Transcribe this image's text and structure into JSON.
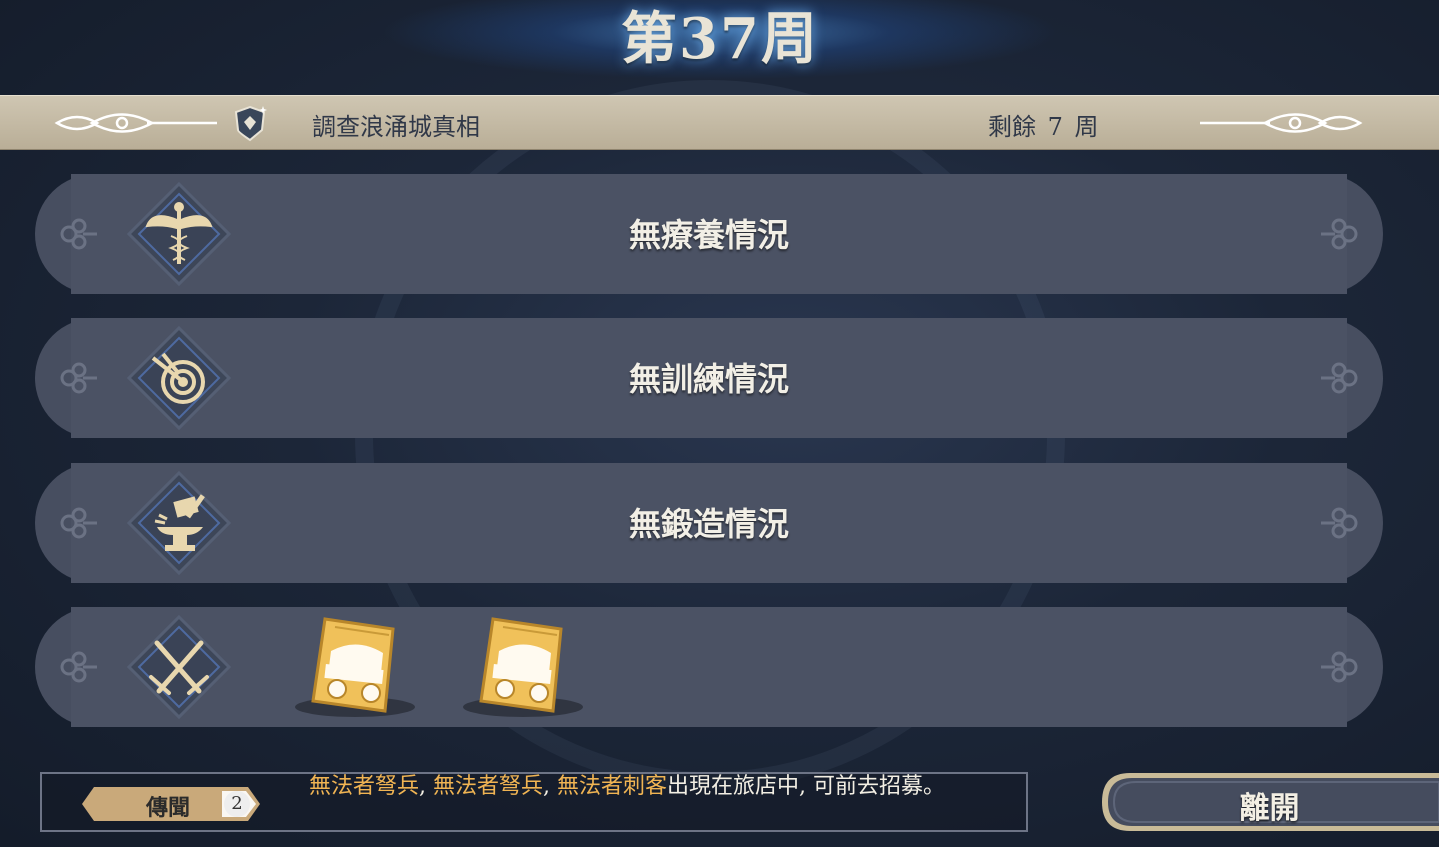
{
  "header": {
    "week_title": "第37周"
  },
  "quest": {
    "name": "調查浪涌城真相",
    "remaining": "剩餘 7 周"
  },
  "rows": [
    {
      "icon": "caduceus-icon",
      "label": "無療養情況"
    },
    {
      "icon": "target-icon",
      "label": "無訓練情況"
    },
    {
      "icon": "anvil-icon",
      "label": "無鍛造情況"
    },
    {
      "icon": "crossed-swords-icon",
      "label": ""
    }
  ],
  "reward_cards": [
    {
      "icon": "wagon-card-icon"
    },
    {
      "icon": "wagon-card-icon"
    }
  ],
  "rumor": {
    "label": "傳聞",
    "count": "2",
    "unit1": "無法者弩兵",
    "sep1": ", ",
    "unit2": "無法者弩兵",
    "sep2": ", ",
    "unit3": "無法者刺客",
    "rest": "出現在旅店中, 可前去招募。"
  },
  "buttons": {
    "leave": "離開"
  },
  "colors": {
    "highlight": "#f0b453",
    "row_bg": "#4b5264",
    "quest_bar": "#c4baa4"
  }
}
